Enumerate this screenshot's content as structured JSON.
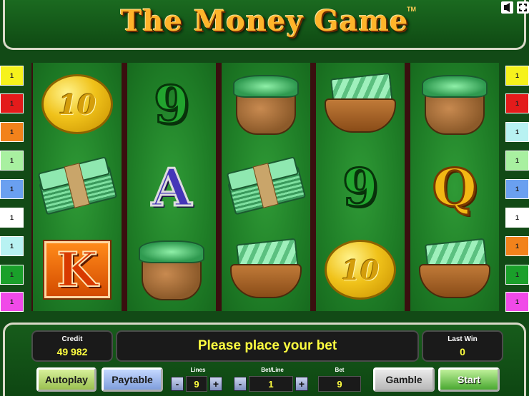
{
  "title": {
    "text": "The Money Game",
    "tm": "TM"
  },
  "icons": {
    "sound": "sound-icon",
    "fullscreen": "fullscreen-icon"
  },
  "line_markers": {
    "left": [
      {
        "label": "1",
        "color": "#f6f21c"
      },
      {
        "label": "1",
        "color": "#e31b1b"
      },
      {
        "label": "1",
        "color": "#f2821b"
      },
      {
        "label": "1",
        "color": "#a8f0a0"
      },
      {
        "label": "1",
        "color": "#6aa0f0"
      },
      {
        "label": "1",
        "color": "#ffffff"
      },
      {
        "label": "1",
        "color": "#b8f2f2"
      },
      {
        "label": "1",
        "color": "#1aa02a"
      },
      {
        "label": "1",
        "color": "#f04ae8"
      }
    ],
    "right": [
      {
        "label": "1",
        "color": "#f6f21c"
      },
      {
        "label": "1",
        "color": "#e31b1b"
      },
      {
        "label": "1",
        "color": "#b8f2f2"
      },
      {
        "label": "1",
        "color": "#a8f0a0"
      },
      {
        "label": "1",
        "color": "#6aa0f0"
      },
      {
        "label": "1",
        "color": "#ffffff"
      },
      {
        "label": "1",
        "color": "#f2821b"
      },
      {
        "label": "1",
        "color": "#1aa02a"
      },
      {
        "label": "1",
        "color": "#f04ae8"
      }
    ]
  },
  "reels": [
    [
      {
        "symbol": "coin",
        "text": "10"
      },
      {
        "symbol": "cash-stack",
        "text": ""
      },
      {
        "symbol": "letter-k",
        "text": "K"
      }
    ],
    [
      {
        "symbol": "letter-nine",
        "text": "9"
      },
      {
        "symbol": "letter-a",
        "text": "A"
      },
      {
        "symbol": "money-bag",
        "text": ""
      }
    ],
    [
      {
        "symbol": "money-bag",
        "text": ""
      },
      {
        "symbol": "cash-stack",
        "text": ""
      },
      {
        "symbol": "wallet",
        "text": ""
      }
    ],
    [
      {
        "symbol": "wallet",
        "text": ""
      },
      {
        "symbol": "letter-nine",
        "text": "9"
      },
      {
        "symbol": "coin",
        "text": "10"
      }
    ],
    [
      {
        "symbol": "money-bag",
        "text": ""
      },
      {
        "symbol": "letter-q",
        "text": "Q"
      },
      {
        "symbol": "wallet",
        "text": ""
      }
    ]
  ],
  "panel": {
    "credit_label": "Credit",
    "credit_value": "49 982",
    "message": "Please place your bet",
    "lastwin_label": "Last Win",
    "lastwin_value": "0",
    "lines_label": "Lines",
    "lines_value": "9",
    "betline_label": "Bet/Line",
    "betline_value": "1",
    "bet_label": "Bet",
    "bet_value": "9",
    "minus": "-",
    "plus": "+",
    "autoplay": "Autoplay",
    "paytable": "Paytable",
    "gamble": "Gamble",
    "start": "Start"
  }
}
